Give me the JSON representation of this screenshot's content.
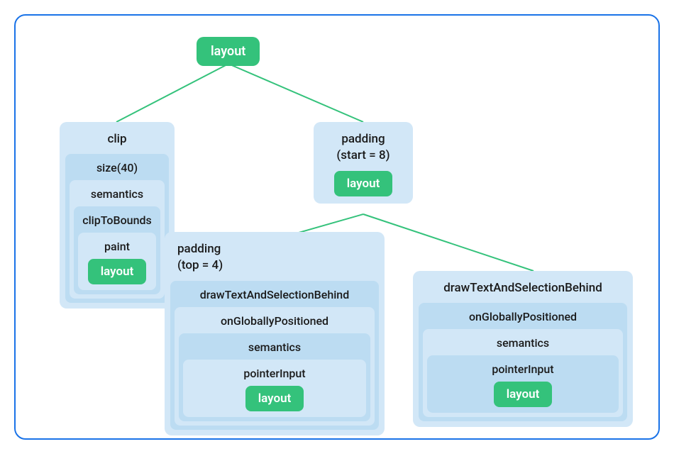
{
  "root": {
    "label": "layout"
  },
  "leftBox": {
    "title": "clip",
    "n1": "size(40)",
    "n2": "semantics",
    "n3": "clipToBounds",
    "n4": "paint",
    "leaf": "layout"
  },
  "midBox": {
    "line1": "padding",
    "line2": "(start = 8)",
    "leaf": "layout"
  },
  "bottomLeft": {
    "line1": "padding",
    "line2": "(top = 4)",
    "n1": "drawTextAndSelectionBehind",
    "n2": "onGloballyPositioned",
    "n3": "semantics",
    "n4": "pointerInput",
    "leaf": "layout"
  },
  "bottomRight": {
    "n1": "drawTextAndSelectionBehind",
    "n2": "onGloballyPositioned",
    "n3": "semantics",
    "n4": "pointerInput",
    "leaf": "layout"
  }
}
